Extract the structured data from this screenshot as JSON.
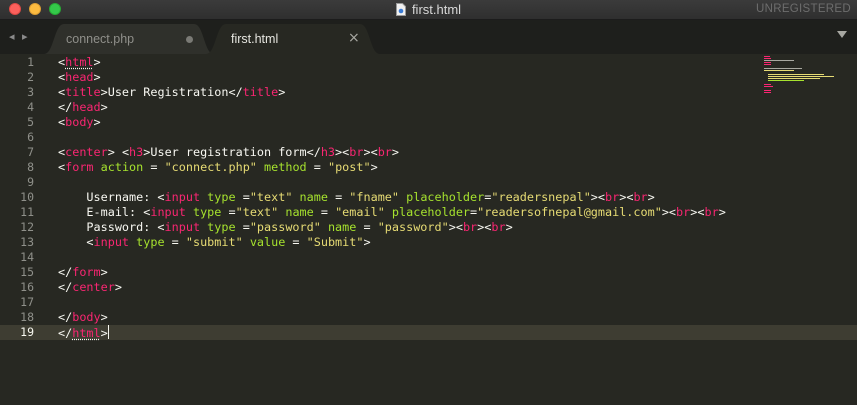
{
  "window": {
    "title": "first.html",
    "unregistered": "UNREGISTERED"
  },
  "tabs": [
    {
      "label": "connect.php",
      "active": false,
      "modified": true
    },
    {
      "label": "first.html",
      "active": true
    }
  ],
  "icons": {
    "close_tab": "×",
    "nav": "◂ ▸"
  },
  "colors": {
    "background": "#272822",
    "tag": "#f92672",
    "attribute": "#a6e22e",
    "string": "#e6db74",
    "text": "#f8f8f2",
    "line_number": "#8f908a"
  },
  "editor": {
    "active_line": 19,
    "lines": [
      {
        "n": "1",
        "tokens": [
          {
            "t": "<"
          },
          {
            "t": "html",
            "c": "tg",
            "u": true
          },
          {
            "t": ">"
          }
        ]
      },
      {
        "n": "2",
        "tokens": [
          {
            "t": "<"
          },
          {
            "t": "head",
            "c": "tg"
          },
          {
            "t": ">"
          }
        ]
      },
      {
        "n": "3",
        "tokens": [
          {
            "t": "<"
          },
          {
            "t": "title",
            "c": "tg"
          },
          {
            "t": ">User Registration</"
          },
          {
            "t": "title",
            "c": "tg"
          },
          {
            "t": ">"
          }
        ]
      },
      {
        "n": "4",
        "tokens": [
          {
            "t": "</"
          },
          {
            "t": "head",
            "c": "tg"
          },
          {
            "t": ">"
          }
        ]
      },
      {
        "n": "5",
        "tokens": [
          {
            "t": "<"
          },
          {
            "t": "body",
            "c": "tg"
          },
          {
            "t": ">"
          }
        ]
      },
      {
        "n": "6",
        "tokens": []
      },
      {
        "n": "7",
        "tokens": [
          {
            "t": "<"
          },
          {
            "t": "center",
            "c": "tg"
          },
          {
            "t": "> <"
          },
          {
            "t": "h3",
            "c": "tg"
          },
          {
            "t": ">User registration form</"
          },
          {
            "t": "h3",
            "c": "tg"
          },
          {
            "t": "><"
          },
          {
            "t": "br",
            "c": "tg"
          },
          {
            "t": "><"
          },
          {
            "t": "br",
            "c": "tg"
          },
          {
            "t": ">"
          }
        ]
      },
      {
        "n": "8",
        "tokens": [
          {
            "t": "<"
          },
          {
            "t": "form",
            "c": "tg"
          },
          {
            "t": " "
          },
          {
            "t": "action",
            "c": "at"
          },
          {
            "t": " = "
          },
          {
            "t": "\"connect.php\"",
            "c": "st"
          },
          {
            "t": " "
          },
          {
            "t": "method",
            "c": "at"
          },
          {
            "t": " = "
          },
          {
            "t": "\"post\"",
            "c": "st"
          },
          {
            "t": ">"
          }
        ]
      },
      {
        "n": "9",
        "tokens": []
      },
      {
        "n": "10",
        "tokens": [
          {
            "t": "    Username: <"
          },
          {
            "t": "input",
            "c": "tg"
          },
          {
            "t": " "
          },
          {
            "t": "type",
            "c": "at"
          },
          {
            "t": " ="
          },
          {
            "t": "\"text\"",
            "c": "st"
          },
          {
            "t": " "
          },
          {
            "t": "name",
            "c": "at"
          },
          {
            "t": " = "
          },
          {
            "t": "\"fname\"",
            "c": "st"
          },
          {
            "t": " "
          },
          {
            "t": "placeholder",
            "c": "at"
          },
          {
            "t": "="
          },
          {
            "t": "\"readersnepal\"",
            "c": "st"
          },
          {
            "t": "><"
          },
          {
            "t": "br",
            "c": "tg"
          },
          {
            "t": "><"
          },
          {
            "t": "br",
            "c": "tg"
          },
          {
            "t": ">"
          }
        ]
      },
      {
        "n": "11",
        "tokens": [
          {
            "t": "    E-mail: <"
          },
          {
            "t": "input",
            "c": "tg"
          },
          {
            "t": " "
          },
          {
            "t": "type",
            "c": "at"
          },
          {
            "t": " ="
          },
          {
            "t": "\"text\"",
            "c": "st"
          },
          {
            "t": " "
          },
          {
            "t": "name",
            "c": "at"
          },
          {
            "t": " = "
          },
          {
            "t": "\"email\"",
            "c": "st"
          },
          {
            "t": " "
          },
          {
            "t": "placeholder",
            "c": "at"
          },
          {
            "t": "="
          },
          {
            "t": "\"readersofnepal@gmail.com\"",
            "c": "st"
          },
          {
            "t": "><"
          },
          {
            "t": "br",
            "c": "tg"
          },
          {
            "t": "><"
          },
          {
            "t": "br",
            "c": "tg"
          },
          {
            "t": ">"
          }
        ]
      },
      {
        "n": "12",
        "tokens": [
          {
            "t": "    Password: <"
          },
          {
            "t": "input",
            "c": "tg"
          },
          {
            "t": " "
          },
          {
            "t": "type",
            "c": "at"
          },
          {
            "t": " ="
          },
          {
            "t": "\"password\"",
            "c": "st"
          },
          {
            "t": " "
          },
          {
            "t": "name",
            "c": "at"
          },
          {
            "t": " = "
          },
          {
            "t": "\"password\"",
            "c": "st"
          },
          {
            "t": "><"
          },
          {
            "t": "br",
            "c": "tg"
          },
          {
            "t": "><"
          },
          {
            "t": "br",
            "c": "tg"
          },
          {
            "t": ">"
          }
        ]
      },
      {
        "n": "13",
        "tokens": [
          {
            "t": "    <"
          },
          {
            "t": "input",
            "c": "tg"
          },
          {
            "t": " "
          },
          {
            "t": "type",
            "c": "at"
          },
          {
            "t": " = "
          },
          {
            "t": "\"submit\"",
            "c": "st"
          },
          {
            "t": " "
          },
          {
            "t": "value",
            "c": "at"
          },
          {
            "t": " = "
          },
          {
            "t": "\"Submit\"",
            "c": "st"
          },
          {
            "t": ">"
          }
        ]
      },
      {
        "n": "14",
        "tokens": []
      },
      {
        "n": "15",
        "tokens": [
          {
            "t": "</"
          },
          {
            "t": "form",
            "c": "tg"
          },
          {
            "t": ">"
          }
        ]
      },
      {
        "n": "16",
        "tokens": [
          {
            "t": "</"
          },
          {
            "t": "center",
            "c": "tg"
          },
          {
            "t": ">"
          }
        ]
      },
      {
        "n": "17",
        "tokens": []
      },
      {
        "n": "18",
        "tokens": [
          {
            "t": "</"
          },
          {
            "t": "body",
            "c": "tg"
          },
          {
            "t": ">"
          }
        ]
      },
      {
        "n": "19",
        "tokens": [
          {
            "t": "</"
          },
          {
            "t": "html",
            "c": "tg",
            "u": true
          },
          {
            "t": ">"
          }
        ]
      }
    ]
  }
}
